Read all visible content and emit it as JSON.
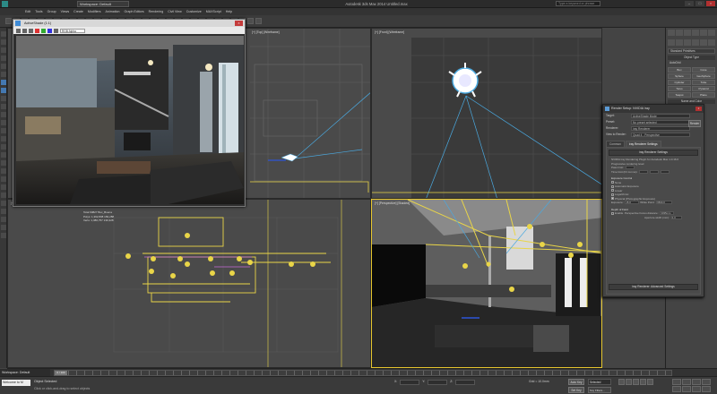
{
  "app": {
    "title": "Autodesk 3ds Max 2014    Untitled.max",
    "workspace": "Workspace: Default",
    "search_placeholder": "Type a keyword or phrase"
  },
  "menu": [
    "Edit",
    "Tools",
    "Group",
    "Views",
    "Create",
    "Modifiers",
    "Animation",
    "Graph Editors",
    "Rendering",
    "Civil View",
    "Customize",
    "MAXScript",
    "Help"
  ],
  "frame_buffer": {
    "title": "ActiveShade (1:1)",
    "channel": "RGB Alpha"
  },
  "viewports": {
    "top": "[+] [Top] [Wireframe]",
    "front": "[+] [Front] [Wireframe]",
    "left": "[+] [Left] [Wireframe]",
    "perspective": "[+] [Perspective] [Shaded]"
  },
  "left_view_stats": {
    "lines": [
      "Total   60827   Box_Buena",
      "Polys:   1,392,838   169,288",
      "Verts:   1,380,757   139,328"
    ]
  },
  "command_panel": {
    "dropdown": "Standard Primitives",
    "object_type_header": "Object Type",
    "autogrid": "AutoGrid",
    "primitives": [
      "Box",
      "Cone",
      "Sphere",
      "GeoSphere",
      "Cylinder",
      "Tube",
      "Torus",
      "Pyramid",
      "Teapot",
      "Plane"
    ],
    "name_header": "Name and Color"
  },
  "render_setup": {
    "title": "Render Setup: NVIDIA iray",
    "target_label": "Target:",
    "target_value": "ActiveShade Mode",
    "preset_label": "Preset:",
    "preset_value": "No preset selected",
    "renderer_label": "Renderer:",
    "renderer_value": "iray Renderer",
    "view_label": "View to Render:",
    "view_value": "Quad 4 - Perspective",
    "render_button": "Render",
    "tabs": [
      "Common",
      "iray Renderer Settings"
    ],
    "rollout_main": "iray Renderer Settings",
    "plugin_line": "NVIDIA iray Rendering Plugin for Autodesk Max 1.0.16.0",
    "progressive_label": "Progressive rendering level:",
    "passes_label": "Pass limit:",
    "passes_value": "1",
    "time_label": "Time limit (hh:mm:ss):",
    "time_values": [
      "0",
      "5",
      "0"
    ],
    "exposure_header": "Exposure Control",
    "exposure_none": "None",
    "exposure_auto": "Automatic Exposure",
    "exposure_linear": "Linear",
    "exposure_log": "Logarithmic",
    "exposure_physical": "Physical (Photographic Exposure)",
    "preset_field_label": "Preset:",
    "exposure_value_label": "Exposure:",
    "exposure_value": "15.0",
    "whitepoint_label": "White Point:",
    "whitepoint_value": "6500.0",
    "dof_header": "Depth of Field",
    "dof_enable": "Enable",
    "focus_label": "Perspective Focus distance:",
    "focus_value": "3035mm",
    "aperture_label": "Aperture width (mm):",
    "aperture_value": "1.0",
    "advanced_rollout": "iray Renderer: Advanced Settings"
  },
  "timeline": {
    "workspace": "Workspace: Default",
    "frame": "0 / 100"
  },
  "status": {
    "maxscript": "Welcome to M",
    "selected": "Object Selected",
    "prompt": "Click or click-and-drag to select objects",
    "x_label": "X:",
    "y_label": "Y:",
    "z_label": "Z:",
    "grid": "Grid = 10.0mm",
    "auto_key": "Auto Key",
    "selected_dd": "Selected",
    "set_key": "Set Key",
    "key_filters": "Key Filters..."
  },
  "colors": {
    "active_border": "#e6c62e",
    "wire_yellow": "#e9d548",
    "wire_blue": "#4aa9e0",
    "bg_dark": "#444444"
  }
}
